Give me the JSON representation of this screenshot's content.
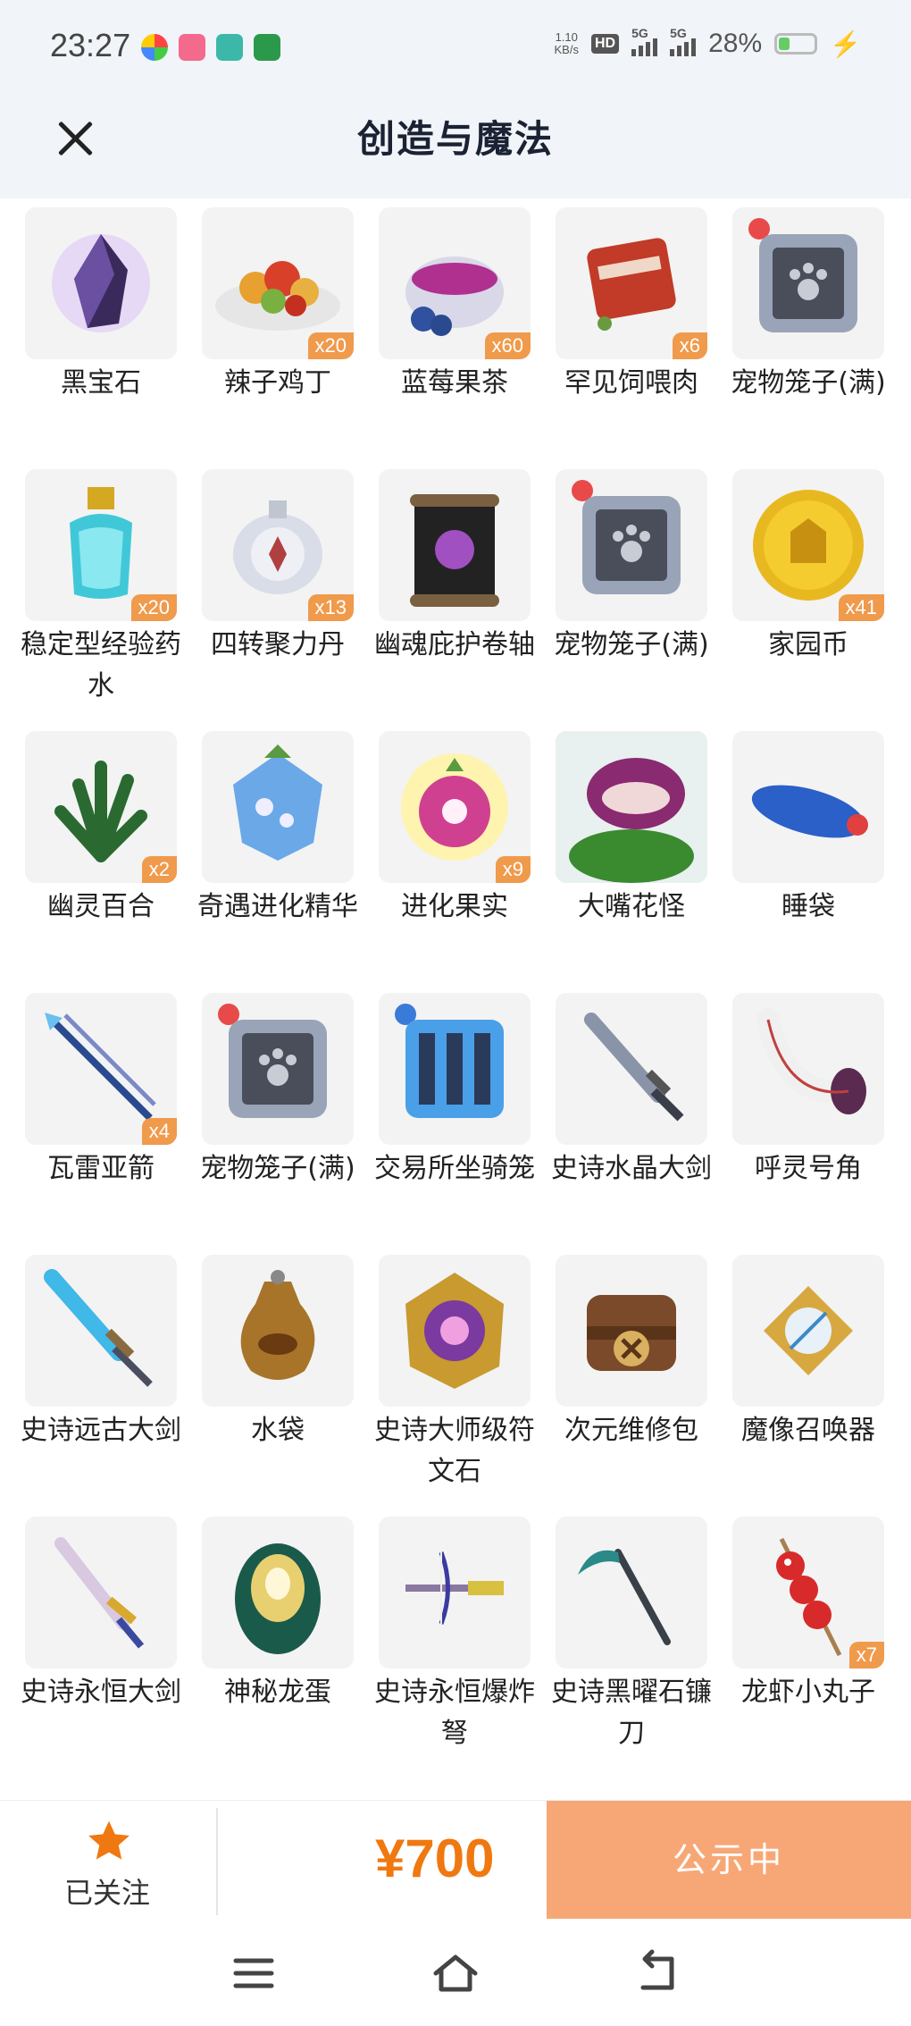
{
  "status_bar": {
    "time": "23:27",
    "net_speed_value": "1.10",
    "net_speed_unit": "KB/s",
    "hd_label": "HD",
    "sim1_label": "5G",
    "sim2_label": "5G",
    "battery": "28%"
  },
  "header": {
    "title": "创造与魔法"
  },
  "items": [
    {
      "name": "黑宝石",
      "qty": "",
      "icon": "black-gem-icon"
    },
    {
      "name": "辣子鸡丁",
      "qty": "x20",
      "icon": "spicy-chicken-icon"
    },
    {
      "name": "蓝莓果茶",
      "qty": "x60",
      "icon": "blueberry-tea-icon"
    },
    {
      "name": "罕见饲喂肉",
      "qty": "x6",
      "icon": "rare-meat-icon"
    },
    {
      "name": "宠物笼子(满)",
      "qty": "",
      "icon": "pet-cage-icon"
    },
    {
      "name": "稳定型经验药水",
      "qty": "x20",
      "icon": "exp-potion-icon"
    },
    {
      "name": "四转聚力丹",
      "qty": "x13",
      "icon": "pill-bottle-icon"
    },
    {
      "name": "幽魂庇护卷轴",
      "qty": "",
      "icon": "scroll-icon"
    },
    {
      "name": "宠物笼子(满)",
      "qty": "",
      "icon": "pet-cage-icon"
    },
    {
      "name": "家园币",
      "qty": "x41",
      "icon": "home-coin-icon"
    },
    {
      "name": "幽灵百合",
      "qty": "x2",
      "icon": "ghost-lily-icon"
    },
    {
      "name": "奇遇进化精华",
      "qty": "",
      "icon": "evolution-essence-icon"
    },
    {
      "name": "进化果实",
      "qty": "x9",
      "icon": "evolution-fruit-icon"
    },
    {
      "name": "大嘴花怪",
      "qty": "",
      "icon": "piranha-plant-icon"
    },
    {
      "name": "睡袋",
      "qty": "",
      "icon": "sleeping-bag-icon"
    },
    {
      "name": "瓦雷亚箭",
      "qty": "x4",
      "icon": "arrow-icon"
    },
    {
      "name": "宠物笼子(满)",
      "qty": "",
      "icon": "pet-cage-icon"
    },
    {
      "name": "交易所坐骑笼",
      "qty": "",
      "icon": "mount-cage-icon"
    },
    {
      "name": "史诗水晶大剑",
      "qty": "",
      "icon": "crystal-sword-icon"
    },
    {
      "name": "呼灵号角",
      "qty": "",
      "icon": "horn-icon"
    },
    {
      "name": "史诗远古大剑",
      "qty": "",
      "icon": "ancient-sword-icon"
    },
    {
      "name": "水袋",
      "qty": "",
      "icon": "water-bag-icon"
    },
    {
      "name": "史诗大师级符文石",
      "qty": "",
      "icon": "rune-stone-icon"
    },
    {
      "name": "次元维修包",
      "qty": "",
      "icon": "repair-kit-icon"
    },
    {
      "name": "魔像召唤器",
      "qty": "",
      "icon": "golem-summoner-icon"
    },
    {
      "name": "史诗永恒大剑",
      "qty": "",
      "icon": "eternal-sword-icon"
    },
    {
      "name": "神秘龙蛋",
      "qty": "",
      "icon": "dragon-egg-icon"
    },
    {
      "name": "史诗永恒爆炸弩",
      "qty": "",
      "icon": "crossbow-icon"
    },
    {
      "name": "史诗黑曜石镰刀",
      "qty": "",
      "icon": "scythe-icon"
    },
    {
      "name": "龙虾小丸子",
      "qty": "x7",
      "icon": "skewer-icon"
    }
  ],
  "bottom_bar": {
    "follow_label": "已关注",
    "price": "¥700",
    "status_label": "公示中"
  },
  "colors": {
    "accent": "#f07810",
    "status_button": "#f7a776",
    "qty_badge": "#f09a4c",
    "header_bg": "#f1f4f8"
  }
}
